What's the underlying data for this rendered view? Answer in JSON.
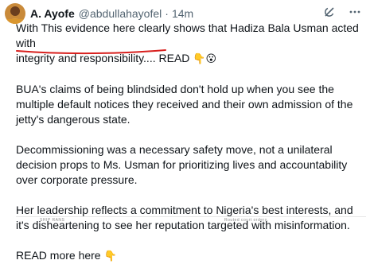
{
  "author": {
    "name": "A. Ayofe",
    "handle": "@abdullahayofel",
    "separator": "·",
    "time": "14m"
  },
  "icons": {
    "avatar": "profile-avatar",
    "grok": "grok-icon",
    "more": "more-options-icon"
  },
  "tweet": {
    "line1": "With This evidence here clearly shows that Hadiza Bala Usman acted with",
    "line2_underlined": "integrity and responsibility....",
    "line2_rest": " READ ",
    "line2_emoji1": "👇",
    "line2_emoji2": "😮",
    "para2": "BUA's claims of being blindsided don't hold up when you see the multiple default notices they received and their own admission of the jetty's dangerous state.",
    "para3": "Decommissioning was a necessary safety move, not a unilateral decision props to Ms. Usman for prioritizing lives and accountability over corporate pressure.",
    "para4": "Her leadership reflects a commitment to Nigeria's best interests, and it's disheartening to see her reputation targeted with misinformation.",
    "read_more": "READ more here ",
    "read_more_emoji": "👇"
  },
  "attachment_preview": {
    "left_text": "SHIP RANS",
    "right_text": "Routed court orders."
  },
  "colors": {
    "text": "#0f1419",
    "secondary": "#536471",
    "annotation_red": "#d8201e",
    "emoji_yellow": "#f4b400"
  }
}
